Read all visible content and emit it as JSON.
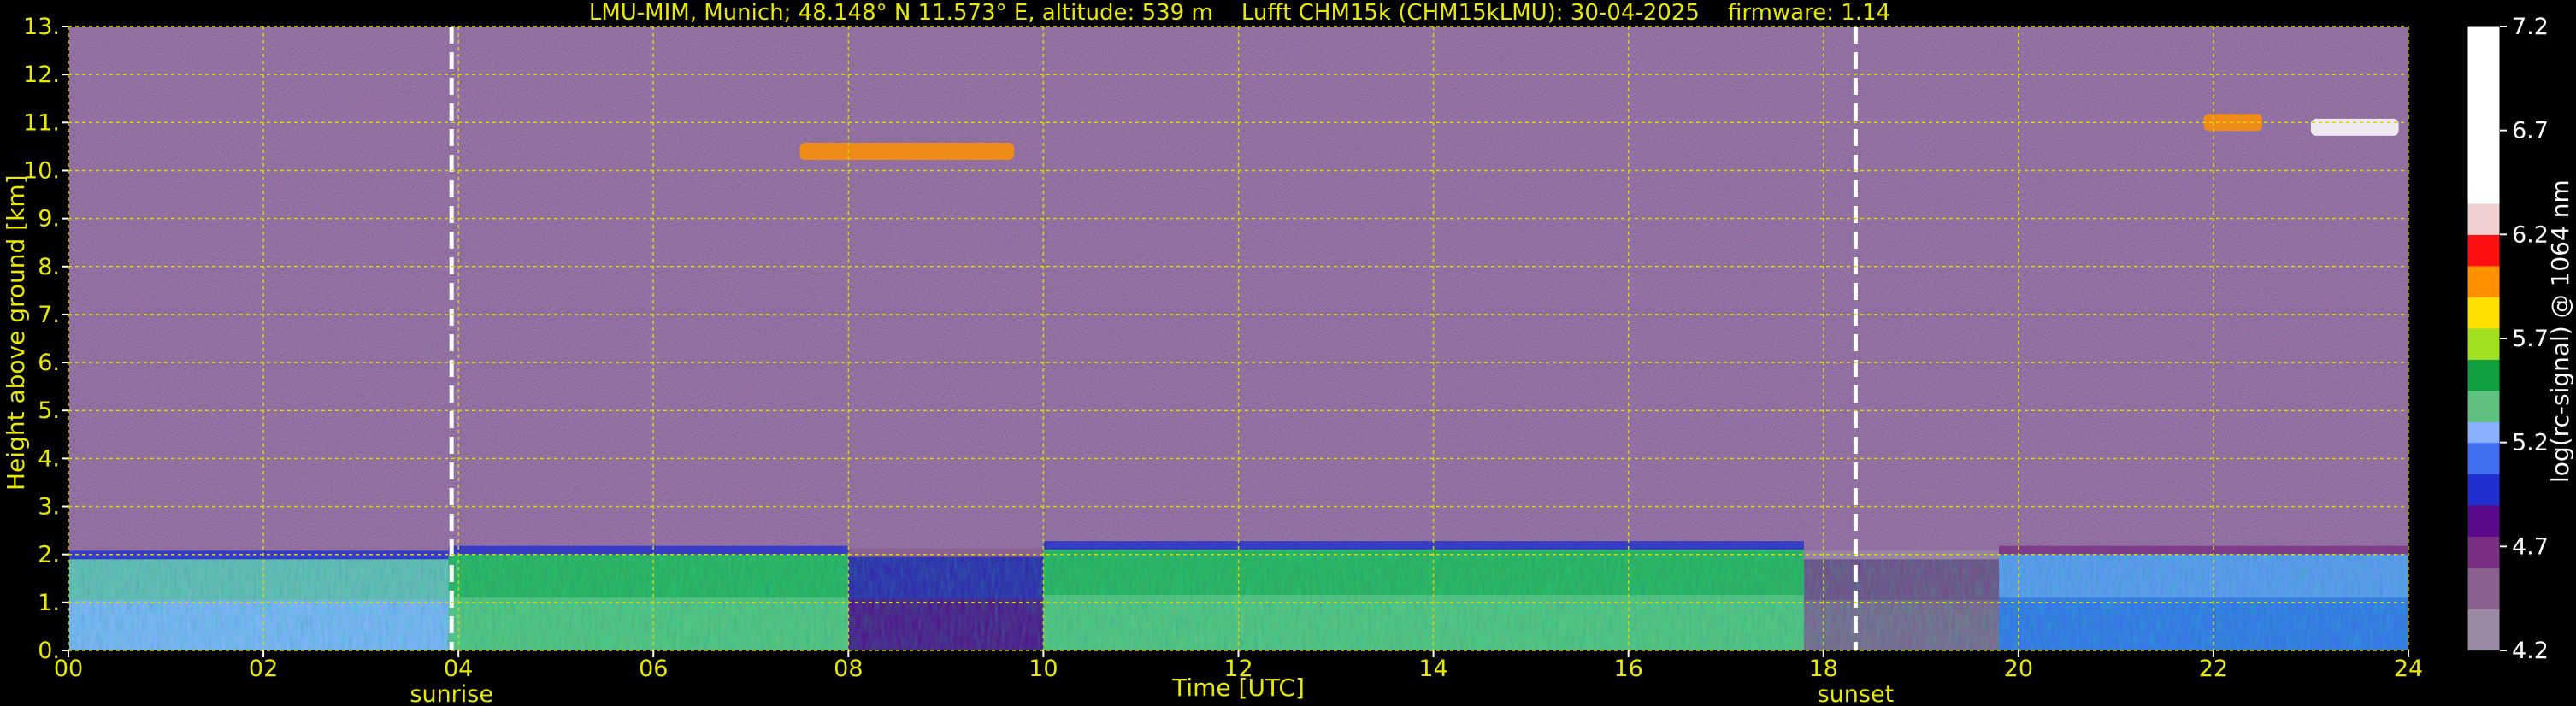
{
  "title": {
    "station": "LMU-MIM, Munich; 48.148° N 11.573° E, altitude: 539 m",
    "instrument": "Lufft CHM15k (CHM15kLMU): 30-04-2025",
    "firmware": "firmware: 1.14"
  },
  "chart_data": {
    "type": "heatmap",
    "xlabel": "Time [UTC]",
    "ylabel": "Height above ground [km]",
    "colorbar_label": "log(rc-signal) @ 1064 nm",
    "xlim": [
      0,
      24
    ],
    "ylim": [
      0,
      13
    ],
    "xticks": [
      "00",
      "02",
      "04",
      "06",
      "08",
      "10",
      "12",
      "14",
      "16",
      "18",
      "20",
      "22",
      "24"
    ],
    "yticks": [
      "0.",
      "1.",
      "2.",
      "3.",
      "4.",
      "5.",
      "6.",
      "7.",
      "8.",
      "9.",
      "10.",
      "11.",
      "12.",
      "13."
    ],
    "grid": true,
    "colorbar": {
      "range": [
        4.2,
        7.2
      ],
      "ticks": [
        "4.2",
        "4.7",
        "5.2",
        "5.7",
        "6.2",
        "6.7",
        "7.2"
      ]
    },
    "annotations": [
      {
        "label": "sunrise",
        "x": 3.93
      },
      {
        "label": "sunset",
        "x": 18.33
      }
    ],
    "boundary_layer_segments": [
      {
        "x0": 0.0,
        "x1": 3.9,
        "top_km": 1.9,
        "level": 5.25
      },
      {
        "x0": 3.9,
        "x1": 8.0,
        "top_km": 2.0,
        "level": 5.35
      },
      {
        "x0": 8.0,
        "x1": 10.0,
        "top_km": 1.95,
        "level": 4.75
      },
      {
        "x0": 10.0,
        "x1": 17.8,
        "top_km": 2.1,
        "level": 5.35
      },
      {
        "x0": 17.8,
        "x1": 19.8,
        "top_km": 1.9,
        "level": 4.5
      },
      {
        "x0": 19.8,
        "x1": 24.0,
        "top_km": 2.0,
        "level": 5.05
      }
    ],
    "cloud_features": [
      {
        "x0": 7.5,
        "x1": 9.7,
        "height_km": 10.4,
        "level": 5.9
      },
      {
        "x0": 21.9,
        "x1": 22.5,
        "height_km": 11.0,
        "level": 5.9
      },
      {
        "x0": 23.0,
        "x1": 23.9,
        "height_km": 10.9,
        "level": 7.0
      }
    ]
  }
}
